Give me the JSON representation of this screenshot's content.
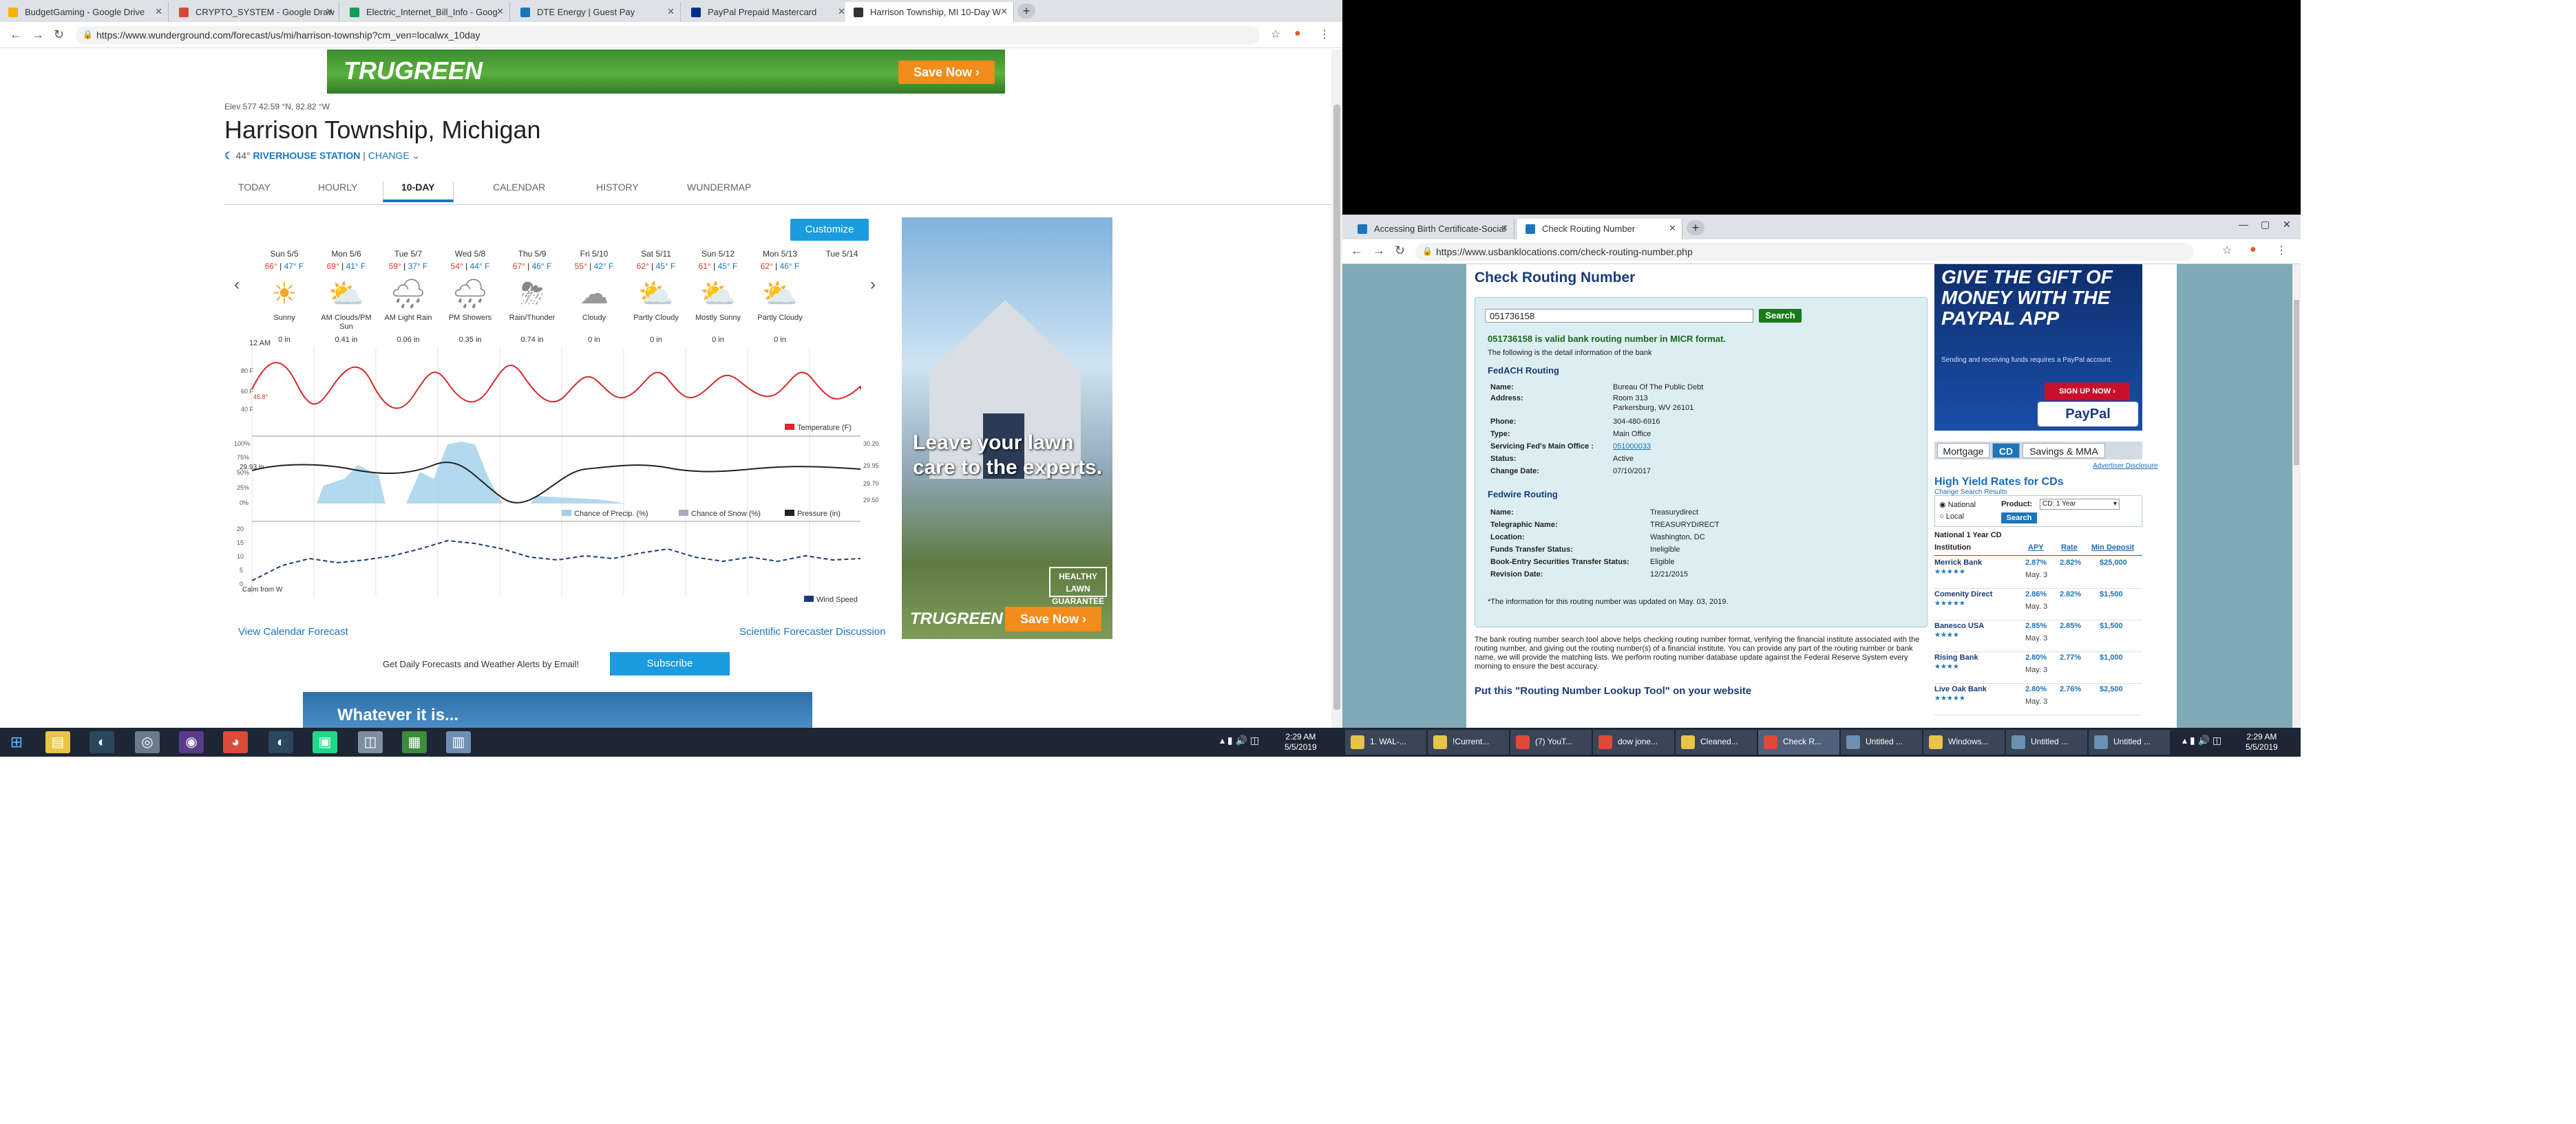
{
  "left": {
    "tabs": [
      {
        "label": "BudgetGaming - Google Drive",
        "color": "#f4b400"
      },
      {
        "label": "CRYPTO_SYSTEM - Google Draw",
        "color": "#db4437"
      },
      {
        "label": "Electric_Internet_Bill_Info - Goog",
        "color": "#0f9d58"
      },
      {
        "label": "DTE Energy | Guest Pay",
        "color": "#1b75bb"
      },
      {
        "label": "PayPal Prepaid Mastercard",
        "color": "#003087"
      },
      {
        "label": "Harrison Township, MI 10-Day W",
        "color": "#333333"
      }
    ],
    "url": "https://www.wunderground.com/forecast/us/mi/harrison-township?cm_ven=localwx_10day",
    "top_ad": {
      "logo": "TRUGREEN",
      "button": "Save Now ›"
    },
    "elev": "Elev 577  42.59 °N, 82.82 °W",
    "title": "Harrison Township, Michigan",
    "station_temp": "44°",
    "station": "RIVERHOUSE STATION",
    "sep": "|",
    "change": "CHANGE",
    "tabs_nav": [
      "TODAY",
      "HOURLY",
      "10-DAY",
      "CALENDAR",
      "HISTORY",
      "WUNDERMAP"
    ],
    "customize": "Customize",
    "days": [
      {
        "d": "Sun 5/5",
        "hi": "66°",
        "lo": "47° F",
        "icon": "☀",
        "cond": "Sunny",
        "p": "0 in"
      },
      {
        "d": "Mon 5/6",
        "hi": "69°",
        "lo": "41° F",
        "icon": "⛅",
        "cond": "AM Clouds/PM Sun",
        "p": "0.41 in"
      },
      {
        "d": "Tue 5/7",
        "hi": "59°",
        "lo": "37° F",
        "icon": "🌧",
        "cond": "AM Light Rain",
        "p": "0.06 in"
      },
      {
        "d": "Wed 5/8",
        "hi": "54°",
        "lo": "44° F",
        "icon": "🌧",
        "cond": "PM Showers",
        "p": "0.35 in"
      },
      {
        "d": "Thu 5/9",
        "hi": "67°",
        "lo": "46° F",
        "icon": "⛈",
        "cond": "Rain/Thunder",
        "p": "0.74 in"
      },
      {
        "d": "Fri 5/10",
        "hi": "55°",
        "lo": "42° F",
        "icon": "☁",
        "cond": "Cloudy",
        "p": "0 in"
      },
      {
        "d": "Sat 5/11",
        "hi": "62°",
        "lo": "45° F",
        "icon": "⛅",
        "cond": "Partly Cloudy",
        "p": "0 in"
      },
      {
        "d": "Sun 5/12",
        "hi": "61°",
        "lo": "45° F",
        "icon": "⛅",
        "cond": "Mostly Sunny",
        "p": "0 in"
      },
      {
        "d": "Mon 5/13",
        "hi": "62°",
        "lo": "46° F",
        "icon": "⛅",
        "cond": "Partly Cloudy",
        "p": "0 in"
      },
      {
        "d": "Tue 5/14",
        "hi": "",
        "lo": "",
        "icon": "",
        "cond": "",
        "p": ""
      }
    ],
    "graph": {
      "time_label": "12 AM",
      "temp_now": "45.8°",
      "temp_axis": [
        "80 F",
        "60 F",
        "40 F"
      ],
      "pct_axis": [
        "100%",
        "75%",
        "50%",
        "25%",
        "0%"
      ],
      "pressure_now": "29.93 in",
      "pressure_axis": [
        "30.20",
        "29.95",
        "29.70",
        "29.50"
      ],
      "wind_axis": [
        "20",
        "15",
        "10",
        "5",
        "0"
      ],
      "wind_label": "Calm from W",
      "legend_temp": "Temperature (F)",
      "legend_precip": "Chance of Precip. (%)",
      "legend_snow": "Chance of Snow (%)",
      "legend_pressure": "Pressure (in)",
      "legend_wind": "Wind Speed",
      "colors": {
        "temp": "#d42b2b",
        "precip": "#9fd0e8",
        "pressure": "#222222",
        "wind": "#1a3c78"
      }
    },
    "view_calendar": "View Calendar Forecast",
    "scientific": "Scientific Forecaster Discussion",
    "alerts_text": "Get Daily Forecasts and Weather Alerts by Email!",
    "subscribe": "Subscribe",
    "side_ad": {
      "text": "Leave your lawn care to the experts.",
      "guarantee": "HEALTHY LAWN GUARANTEE",
      "logo": "TRUGREEN",
      "button": "Save Now ›"
    },
    "bottom_ad": "Whatever it is..."
  },
  "right": {
    "tabs": [
      {
        "label": "Accessing Birth Certificate-Social",
        "color": "#1b75bb"
      },
      {
        "label": "Check Routing Number",
        "color": "#1b75bb"
      }
    ],
    "url": "https://www.usbanklocations.com/check-routing-number.php",
    "title": "Check Routing Number",
    "routing_input": "051736158",
    "search": "Search",
    "valid": "051736158 is valid bank routing number in MICR format.",
    "following": "The following is the detail information of the bank",
    "fedach_title": "FedACH Routing",
    "fedach": [
      {
        "k": "Name:",
        "v": "Bureau Of The Public Debt"
      },
      {
        "k": "Address:",
        "v": "Room 313"
      },
      {
        "k": "",
        "v": "Parkersburg, WV 26101"
      },
      {
        "k": "Phone:",
        "v": "304-480-6916"
      },
      {
        "k": "Type:",
        "v": "Main Office"
      },
      {
        "k": "Servicing Fed's Main Office :",
        "v": "051000033"
      },
      {
        "k": "Status:",
        "v": "Active"
      },
      {
        "k": "Change Date:",
        "v": "07/10/2017"
      }
    ],
    "fedwire_title": "Fedwire Routing",
    "fedwire": [
      {
        "k": "Name:",
        "v": "Treasurydirect"
      },
      {
        "k": "Telegraphic Name:",
        "v": "TREASURYDIRECT"
      },
      {
        "k": "Location:",
        "v": "Washington, DC"
      },
      {
        "k": "Funds Transfer Status:",
        "v": "Ineligible"
      },
      {
        "k": "Book-Entry Securities Transfer Status:",
        "v": "Eligible"
      },
      {
        "k": "Revision Date:",
        "v": "12/21/2015"
      }
    ],
    "updated": "*The information for this routing number was updated on May. 03, 2019.",
    "desc": "The bank routing number search tool above helps checking routing number format, verifying the financial institute associated with the routing number, and giving out the routing number(s) of a financial institute. You can provide any part of the routing number or bank name, we will provide the matching lists. We perform routing number database update against the Federal Reserve System every morning to ensure the best accuracy.",
    "put_tool": "Put this \"Routing Number Lookup Tool\" on your website",
    "paypal": {
      "text": "GIVE THE GIFT OF MONEY WITH THE PAYPAL APP",
      "sub": "Sending and receiving funds requires a PayPal account.",
      "btn": "SIGN UP NOW ›",
      "logo": "PayPal"
    },
    "yield_tabs": [
      "Mortgage",
      "CD",
      "Savings & MMA"
    ],
    "disclosure": "Advertiser Disclosure",
    "yield_title": "High Yield Rates for CDs",
    "change_search": "Change Search Results",
    "radio_national": "National",
    "radio_local": "Local",
    "product_label": "Product:",
    "product_value": "CD: 1 Year",
    "product_search": "Search",
    "subtitle": "National 1 Year CD",
    "headers": [
      "Institution",
      "APY",
      "Rate",
      "Min Deposit"
    ],
    "rows": [
      {
        "inst": "Merrick Bank",
        "apy": "2.87%",
        "rate": "2.82%",
        "min": "$25,000",
        "date": "May. 3"
      },
      {
        "inst": "Comenity Direct",
        "apy": "2.86%",
        "rate": "2.82%",
        "min": "$1,500",
        "date": "May. 3"
      },
      {
        "inst": "Banesco USA",
        "apy": "2.85%",
        "rate": "2.85%",
        "min": "$1,500",
        "date": "May. 3"
      },
      {
        "inst": "Rising Bank",
        "apy": "2.80%",
        "rate": "2.77%",
        "min": "$1,000",
        "date": "May. 3"
      },
      {
        "inst": "Live Oak Bank",
        "apy": "2.80%",
        "rate": "2.76%",
        "min": "$2,500",
        "date": "May. 3"
      }
    ]
  },
  "taskbar_left": {
    "time": "2:29 AM",
    "date": "5/5/2019"
  },
  "taskbar_right": {
    "time": "2:29 AM",
    "date": "5/5/2019",
    "buttons": [
      "1. WAL-...",
      "!Current...",
      "(7) YouT...",
      "dow jone...",
      "Cleaned...",
      "Check R...",
      "Untitled ...",
      "Windows...",
      "Untitled ...",
      "Untitled ..."
    ]
  }
}
